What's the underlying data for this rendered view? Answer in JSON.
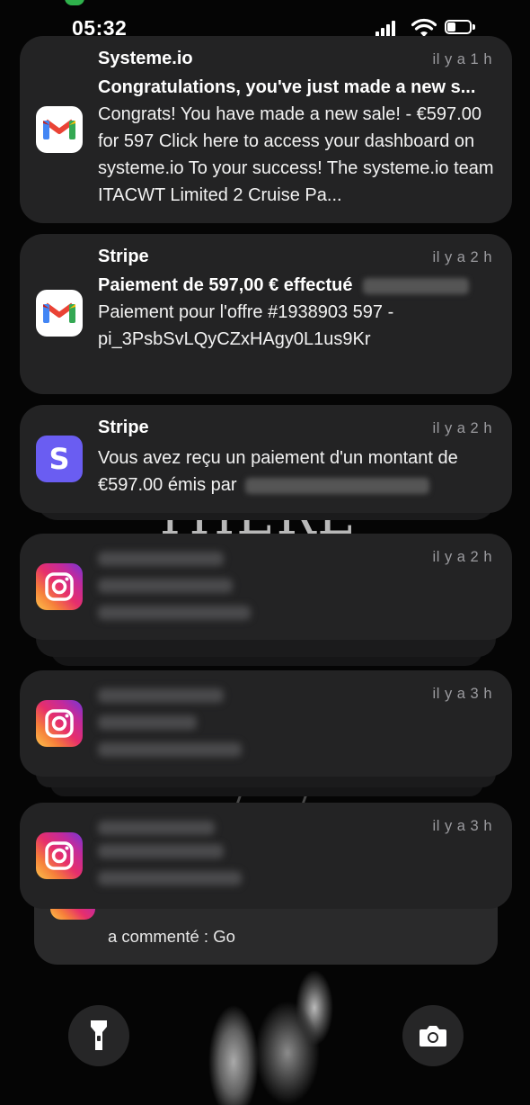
{
  "status_bar": {
    "time": "05:32",
    "signal": "signal-icon",
    "wifi": "wifi-icon",
    "battery": "battery-icon"
  },
  "wallpaper": {
    "text": "THERE IS"
  },
  "notifications": [
    {
      "app": "Systeme.io",
      "icon": "gmail-icon",
      "time": "il y a 1 h",
      "subject": "Congratulations, you've just made a new s...",
      "body": "Congrats! You have made a new sale! - €597.00 for 597 Click here to access your dashboard on systeme.io To your success! The systeme.io team ITACWT Limited 2 Cruise Pa..."
    },
    {
      "app": "Stripe",
      "icon": "gmail-icon",
      "time": "il y a 2 h",
      "subject": "Paiement de 597,00 € effectué",
      "body": "Paiement pour l'offre #1938903 597 - pi_3PsbSvLQyCZxHAgy0L1us9Kr"
    },
    {
      "app": "Stripe",
      "icon": "stripe-icon",
      "icon_letter": "S",
      "time": "il y a 2 h",
      "body": "Vous avez reçu un paiement d'un montant de €597.00 émis par"
    },
    {
      "icon": "instagram-icon",
      "time": "il y a 2 h"
    },
    {
      "icon": "instagram-icon",
      "time": "il y a 3 h"
    },
    {
      "icon": "instagram-icon",
      "time": "il y a 3 h"
    }
  ],
  "bottom_card": {
    "text": "a commenté : Go"
  },
  "controls": {
    "flashlight": "flashlight-icon",
    "camera": "camera-icon"
  },
  "colors": {
    "card": "#232324",
    "stripe": "#6a5df2",
    "gmail_red": "#ea4335"
  }
}
